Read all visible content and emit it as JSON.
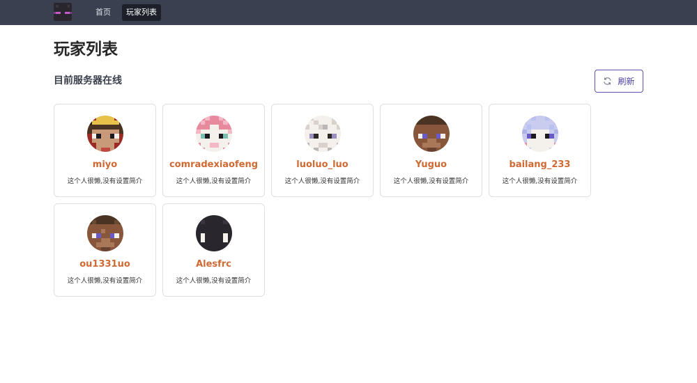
{
  "nav": {
    "logo_icon": "enderman-head-icon",
    "items": [
      {
        "label": "首页",
        "active": false
      },
      {
        "label": "玩家列表",
        "active": true
      }
    ]
  },
  "page": {
    "title": "玩家列表",
    "section_title": "目前服务器在线",
    "refresh_label": "刷新",
    "refresh_icon": "refresh-icon"
  },
  "colors": {
    "navbar": "#3b4050",
    "player_name": "#d06a33",
    "accent": "#4a3f9f"
  },
  "players": [
    {
      "name": "miyo",
      "bio": "这个人很懒,没有设置简介"
    },
    {
      "name": "comradexiaofeng",
      "bio": "这个人很懒,没有设置简介"
    },
    {
      "name": "luoluo_luo",
      "bio": "这个人很懒,没有设置简介"
    },
    {
      "name": "Yuguo",
      "bio": "这个人很懒,没有设置简介"
    },
    {
      "name": "bailang_233",
      "bio": "这个人很懒,没有设置简介"
    },
    {
      "name": "ou1331uo",
      "bio": "这个人很懒,没有设置简介"
    },
    {
      "name": "Alesfrc",
      "bio": "这个人很懒,没有设置简介"
    }
  ]
}
